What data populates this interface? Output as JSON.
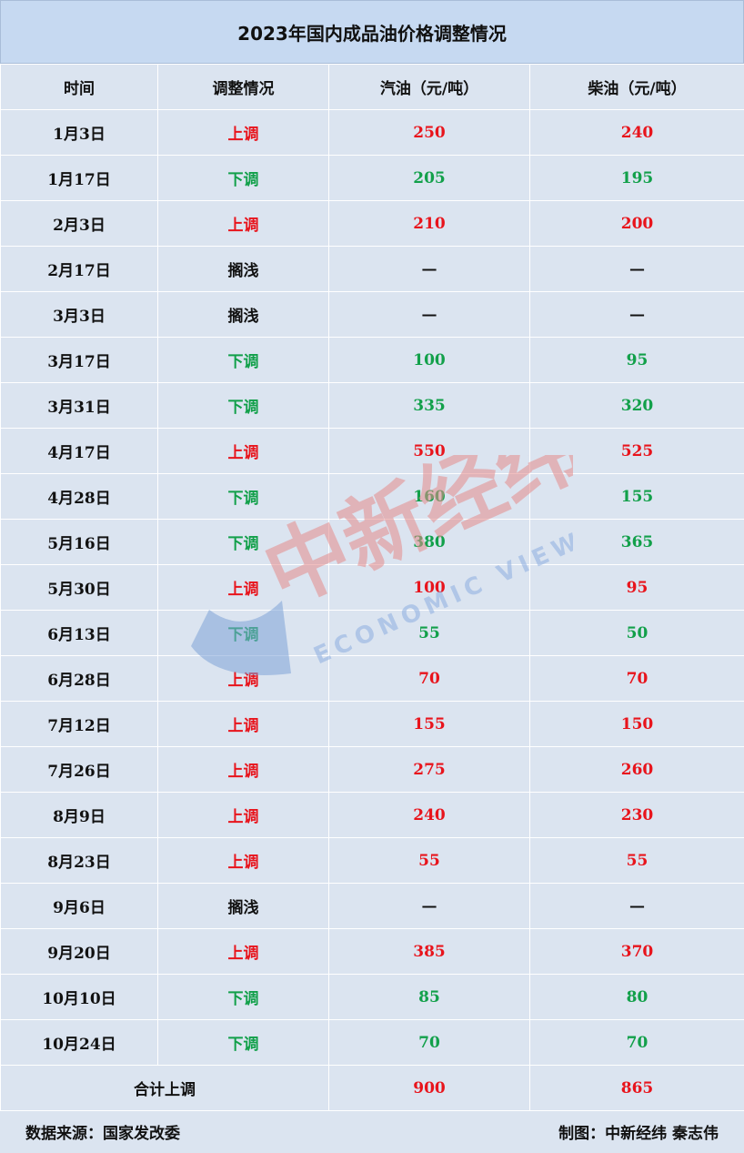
{
  "title": "2023年国内成品油价格调整情况",
  "headers": [
    "时间",
    "调整情况",
    "汽油（元/吨）",
    "柴油（元/吨）"
  ],
  "colors": {
    "up": "#e8141c",
    "down": "#12a04a",
    "header_bg": "#c6d9f1",
    "body_bg": "#dbe4f0"
  },
  "rows": [
    {
      "date": "1月3日",
      "status": "上调",
      "type": "up",
      "gasoline": "250",
      "diesel": "240"
    },
    {
      "date": "1月17日",
      "status": "下调",
      "type": "down",
      "gasoline": "205",
      "diesel": "195"
    },
    {
      "date": "2月3日",
      "status": "上调",
      "type": "up",
      "gasoline": "210",
      "diesel": "200"
    },
    {
      "date": "2月17日",
      "status": "搁浅",
      "type": "none",
      "gasoline": "—",
      "diesel": "—"
    },
    {
      "date": "3月3日",
      "status": "搁浅",
      "type": "none",
      "gasoline": "—",
      "diesel": "—"
    },
    {
      "date": "3月17日",
      "status": "下调",
      "type": "down",
      "gasoline": "100",
      "diesel": "95"
    },
    {
      "date": "3月31日",
      "status": "下调",
      "type": "down",
      "gasoline": "335",
      "diesel": "320"
    },
    {
      "date": "4月17日",
      "status": "上调",
      "type": "up",
      "gasoline": "550",
      "diesel": "525"
    },
    {
      "date": "4月28日",
      "status": "下调",
      "type": "down",
      "gasoline": "160",
      "diesel": "155"
    },
    {
      "date": "5月16日",
      "status": "下调",
      "type": "down",
      "gasoline": "380",
      "diesel": "365"
    },
    {
      "date": "5月30日",
      "status": "上调",
      "type": "up",
      "gasoline": "100",
      "diesel": "95"
    },
    {
      "date": "6月13日",
      "status": "下调",
      "type": "down",
      "gasoline": "55",
      "diesel": "50"
    },
    {
      "date": "6月28日",
      "status": "上调",
      "type": "up",
      "gasoline": "70",
      "diesel": "70"
    },
    {
      "date": "7月12日",
      "status": "上调",
      "type": "up",
      "gasoline": "155",
      "diesel": "150"
    },
    {
      "date": "7月26日",
      "status": "上调",
      "type": "up",
      "gasoline": "275",
      "diesel": "260"
    },
    {
      "date": "8月9日",
      "status": "上调",
      "type": "up",
      "gasoline": "240",
      "diesel": "230"
    },
    {
      "date": "8月23日",
      "status": "上调",
      "type": "up",
      "gasoline": "55",
      "diesel": "55"
    },
    {
      "date": "9月6日",
      "status": "搁浅",
      "type": "none",
      "gasoline": "—",
      "diesel": "—"
    },
    {
      "date": "9月20日",
      "status": "上调",
      "type": "up",
      "gasoline": "385",
      "diesel": "370"
    },
    {
      "date": "10月10日",
      "status": "下调",
      "type": "down",
      "gasoline": "85",
      "diesel": "80"
    },
    {
      "date": "10月24日",
      "status": "下调",
      "type": "down",
      "gasoline": "70",
      "diesel": "70"
    }
  ],
  "total": {
    "label": "合计上调",
    "gasoline": "900",
    "diesel": "865"
  },
  "footer": {
    "source": "数据来源：国家发改委",
    "credit": "制图：中新经纬 秦志伟"
  },
  "watermark": {
    "text_cn": "中新经纬",
    "text_en": "ECONOMIC VIEW"
  }
}
